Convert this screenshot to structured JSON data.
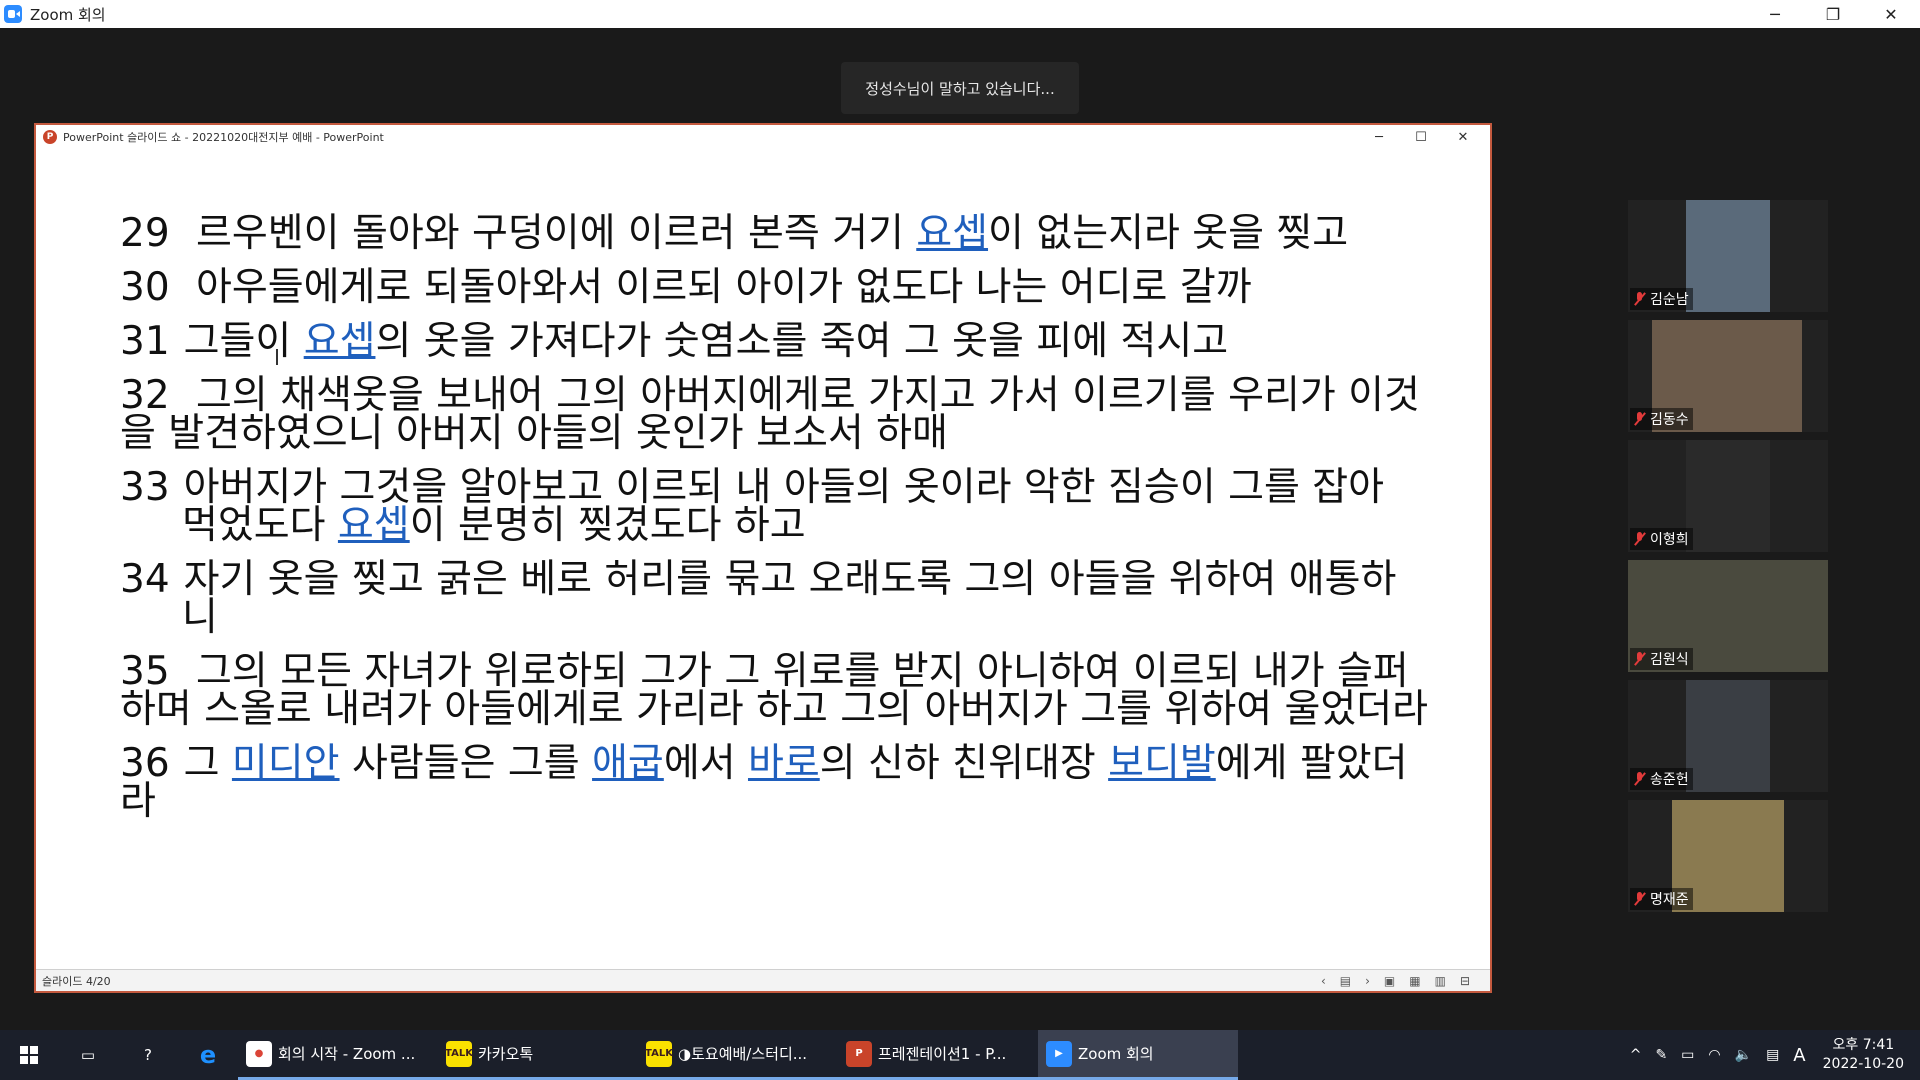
{
  "window": {
    "title": "Zoom 회의",
    "minimize": "─",
    "restore": "❐",
    "close": "✕"
  },
  "toast": {
    "text": "정성수님이 말하고 있습니다..."
  },
  "ppt": {
    "icon": "P",
    "title": "PowerPoint 슬라이드 쇼  -  20221020대전지부 예배  -  PowerPoint",
    "minimize": "─",
    "restore": "☐",
    "close": "✕",
    "status_slide": "슬라이드 4/20",
    "nav_prev": "‹",
    "nav_menu": "▤",
    "nav_next": "›",
    "view1": "▣",
    "view2": "▦",
    "view3": "▥",
    "view4": "⊟"
  },
  "slide": {
    "verses": [
      {
        "num": "29",
        "segments": [
          {
            "text": " 르우벤이 돌아와 구덩이에 이르러 본즉 거기 "
          },
          {
            "text": "요셉",
            "link": true
          },
          {
            "text": "이 없는지라 옷을 찢고"
          }
        ]
      },
      {
        "num": "30",
        "segments": [
          {
            "text": " 아우들에게로 되돌아와서 이르되 아이가 없도다 나는 어디로 갈까"
          }
        ]
      },
      {
        "num": "31",
        "segments": [
          {
            "text": "그들이 "
          },
          {
            "text": "요셉",
            "link": true
          },
          {
            "text": "의 옷을 가져다가 숫염소를 죽여 그 옷을 피에 적시고"
          }
        ]
      },
      {
        "num": "32",
        "segments": [
          {
            "text": " 그의 채색옷을 보내어 그의 아버지에게로 가지고 가서 이르기를 우리가 이것을 발견하였으니 아버지 아들의 옷인가 보소서 하매"
          }
        ]
      },
      {
        "num": "33",
        "hang": true,
        "segments": [
          {
            "text": "아버지가 그것을 알아보고 이르되 내 아들의 옷이라 악한 짐승이 그를 잡아 먹었도다 "
          },
          {
            "text": "요셉",
            "link": true
          },
          {
            "text": "이 분명히 찢겼도다 하고"
          }
        ]
      },
      {
        "num": "34",
        "hang": true,
        "segments": [
          {
            "text": "자기 옷을 찢고 굵은 베로 허리를 묶고 오래도록 그의 아들을 위하여 애통하니"
          }
        ]
      },
      {
        "num": "35",
        "segments": [
          {
            "text": " 그의 모든 자녀가 위로하되 그가 그 위로를 받지 아니하여 이르되 내가 슬퍼하며 스올로 내려가 아들에게로 가리라 하고 그의 아버지가 그를 위하여 울었더라"
          }
        ]
      },
      {
        "num": "36",
        "segments": [
          {
            "text": "그 "
          },
          {
            "text": "미디안",
            "link": true
          },
          {
            "text": " 사람들은 그를 "
          },
          {
            "text": "애굽",
            "link": true
          },
          {
            "text": "에서 "
          },
          {
            "text": "바로",
            "link": true
          },
          {
            "text": "의 신하 친위대장 "
          },
          {
            "text": "보디발",
            "link": true
          },
          {
            "text": "에게 팔았더라"
          }
        ]
      }
    ]
  },
  "participants": [
    {
      "name": "김순남"
    },
    {
      "name": "김동수"
    },
    {
      "name": "이형희"
    },
    {
      "name": "김원식"
    },
    {
      "name": "송준헌"
    },
    {
      "name": "명재준"
    }
  ],
  "taskbar": {
    "apps": [
      {
        "label": "회의 시작 - Zoom ...",
        "icon": "chrome-icon"
      },
      {
        "label": "카카오톡",
        "icon": "kakaotalk-icon"
      },
      {
        "label": "◑토요예배/스터디...",
        "icon": "kakaotalk-icon"
      },
      {
        "label": "프레젠테이션1 - P...",
        "icon": "powerpoint-icon"
      },
      {
        "label": "Zoom 회의",
        "icon": "zoom-icon"
      }
    ],
    "tray": {
      "chevron": "^",
      "ime": "A",
      "time": "오후 7:41",
      "date": "2022-10-20"
    }
  }
}
